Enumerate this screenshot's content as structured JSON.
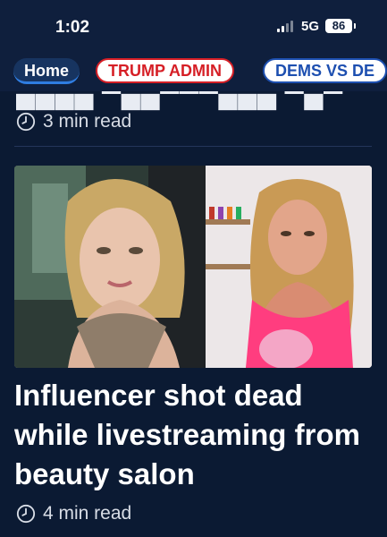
{
  "status_bar": {
    "time": "1:02",
    "network": "5G",
    "battery": "86"
  },
  "tabs": [
    {
      "label": "Home",
      "active": true
    },
    {
      "label": "TRUMP ADMIN",
      "color": "#d61f26"
    },
    {
      "label": "DEMS VS DE",
      "color": "#1d4fb0"
    }
  ],
  "feed": {
    "prev_article": {
      "read_time": "3 min read"
    },
    "article": {
      "headline": "Influencer shot dead while livestreaming from beauty salon",
      "read_time": "4 min read"
    }
  },
  "colors": {
    "background": "#0b1a33",
    "header": "#0f1f3d",
    "active_tab": "#173460",
    "accent_red": "#d61f26",
    "accent_blue": "#1d4fb0"
  }
}
